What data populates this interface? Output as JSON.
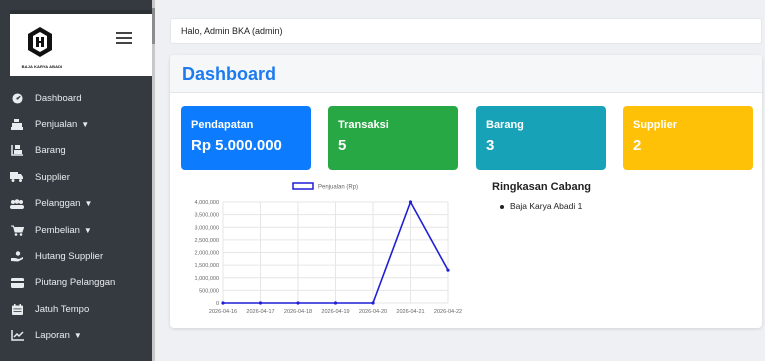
{
  "sidebar": {
    "brand": "BAJA KARYA ABADI",
    "items": [
      {
        "label": "Dashboard",
        "icon": "dashboard-icon",
        "has_submenu": false
      },
      {
        "label": "Penjualan",
        "icon": "cash-register-icon",
        "has_submenu": true
      },
      {
        "label": "Barang",
        "icon": "dolly-boxes-icon",
        "has_submenu": false
      },
      {
        "label": "Supplier",
        "icon": "truck-icon",
        "has_submenu": false
      },
      {
        "label": "Pelanggan",
        "icon": "users-icon",
        "has_submenu": true
      },
      {
        "label": "Pembelian",
        "icon": "cart-icon",
        "has_submenu": true
      },
      {
        "label": "Hutang Supplier",
        "icon": "hand-holding-icon",
        "has_submenu": false
      },
      {
        "label": "Piutang Pelanggan",
        "icon": "credit-card-icon",
        "has_submenu": false
      },
      {
        "label": "Jatuh Tempo",
        "icon": "calendar-icon",
        "has_submenu": false
      },
      {
        "label": "Laporan",
        "icon": "line-chart-icon",
        "has_submenu": true
      }
    ]
  },
  "navbar": {
    "greeting": "Halo, Admin BKA (admin)"
  },
  "page": {
    "title": "Dashboard"
  },
  "stats": [
    {
      "label": "Pendapatan",
      "value": "Rp 5.000.000",
      "color": "#0d7bfd"
    },
    {
      "label": "Transaksi",
      "value": "5",
      "color": "#28a745"
    },
    {
      "label": "Barang",
      "value": "3",
      "color": "#17a2b8"
    },
    {
      "label": "Supplier",
      "value": "2",
      "color": "#ffc107"
    }
  ],
  "summary": {
    "title": "Ringkasan Cabang",
    "branches": [
      "Baja Karya Abadi 1"
    ]
  },
  "chart_data": {
    "type": "line",
    "categories": [
      "2026-04-16",
      "2026-04-17",
      "2026-04-18",
      "2026-04-19",
      "2026-04-20",
      "2026-04-21",
      "2026-04-22"
    ],
    "series": [
      {
        "name": "Penjualan (Rp)",
        "values": [
          0,
          0,
          0,
          0,
          0,
          4000000,
          1300000
        ],
        "color": "#1f1fd6"
      }
    ],
    "yticks": [
      "0",
      "500,000",
      "1,000,000",
      "1,500,000",
      "2,000,000",
      "2,500,000",
      "3,000,000",
      "3,500,000",
      "4,000,000"
    ],
    "ylim": [
      0,
      4000000
    ],
    "grid": true,
    "legend": "top"
  }
}
